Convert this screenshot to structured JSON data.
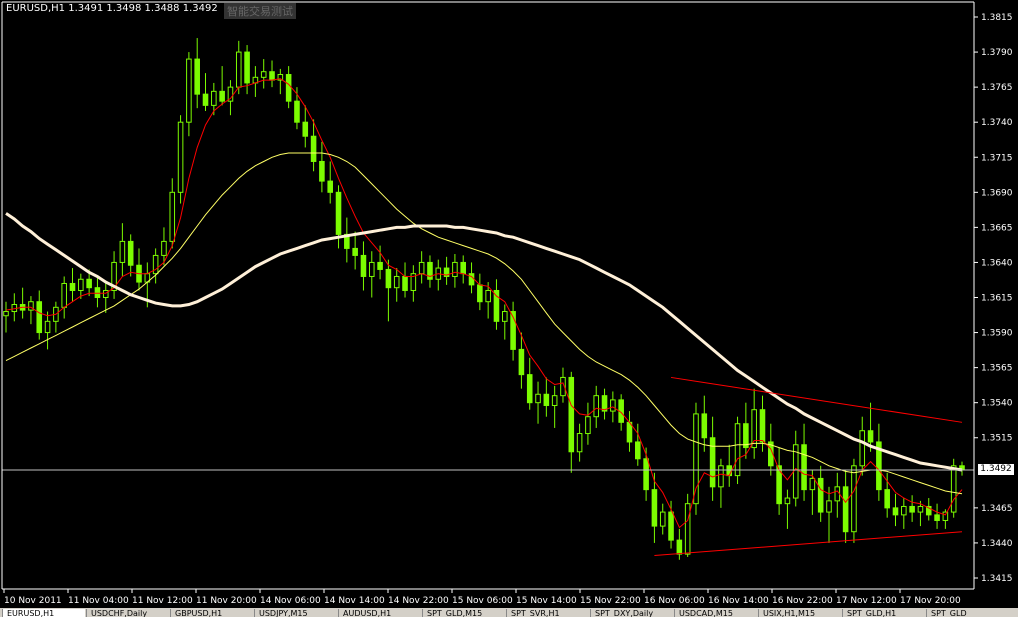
{
  "header": {
    "symbol": "EURUSD,H1",
    "ohlc": "1.3491 1.3498 1.3488 1.3492",
    "watermark": "智能交易测试"
  },
  "current_price_label": "1.3492",
  "colors": {
    "background": "#000000",
    "candle": "#7CFC00",
    "axis": "#ffffff",
    "ma_fast": "#ff0000",
    "ma_mid": "#ffff66",
    "ma_slow": "#fff0d8",
    "trendline": "#ff0000"
  },
  "tabs": [
    "EURUSD,H1",
    "USDCHF,Daily",
    "GBPUSD,H1",
    "USDJPY,M15",
    "AUDUSD,H1",
    "SPT_GLD,M15",
    "SPT_SVR,H1",
    "SPT_DXY,Daily",
    "USDCAD,M15",
    "USIX,H1,M15",
    "SPT_GLD,H1",
    "SPT_GLD"
  ],
  "chart_data": {
    "type": "candlestick",
    "yaxis_ticks": [
      "1.3815",
      "1.3790",
      "1.3765",
      "1.3740",
      "1.3715",
      "1.3690",
      "1.3665",
      "1.3640",
      "1.3615",
      "1.3590",
      "1.3565",
      "1.3540",
      "1.3515",
      "1.3465",
      "1.3440",
      "1.3415"
    ],
    "ylim": [
      1.341,
      1.382
    ],
    "xaxis_ticks": [
      "10 Nov 2011",
      "11 Nov 04:00",
      "11 Nov 12:00",
      "11 Nov 20:00",
      "14 Nov 06:00",
      "14 Nov 14:00",
      "14 Nov 22:00",
      "15 Nov 06:00",
      "15 Nov 14:00",
      "15 Nov 22:00",
      "16 Nov 06:00",
      "16 Nov 14:00",
      "16 Nov 22:00",
      "17 Nov 12:00",
      "17 Nov 20:00"
    ],
    "current_price": 1.3492,
    "candles": [
      [
        1.3602,
        1.3612,
        1.359,
        1.3605
      ],
      [
        1.3605,
        1.3618,
        1.3598,
        1.361
      ],
      [
        1.361,
        1.3622,
        1.36,
        1.3606
      ],
      [
        1.3606,
        1.3616,
        1.3596,
        1.3612
      ],
      [
        1.3612,
        1.362,
        1.3585,
        1.359
      ],
      [
        1.359,
        1.3605,
        1.3578,
        1.3598
      ],
      [
        1.3598,
        1.3612,
        1.359,
        1.3608
      ],
      [
        1.3608,
        1.363,
        1.36,
        1.3625
      ],
      [
        1.3625,
        1.3636,
        1.3612,
        1.362
      ],
      [
        1.362,
        1.3632,
        1.3614,
        1.3628
      ],
      [
        1.3628,
        1.3635,
        1.3616,
        1.3622
      ],
      [
        1.3622,
        1.363,
        1.3608,
        1.3615
      ],
      [
        1.3615,
        1.3626,
        1.3604,
        1.362
      ],
      [
        1.362,
        1.3648,
        1.3614,
        1.364
      ],
      [
        1.364,
        1.3668,
        1.363,
        1.3655
      ],
      [
        1.3655,
        1.366,
        1.363,
        1.3638
      ],
      [
        1.3638,
        1.365,
        1.362,
        1.3626
      ],
      [
        1.3626,
        1.364,
        1.3608,
        1.3632
      ],
      [
        1.3632,
        1.365,
        1.3625,
        1.3645
      ],
      [
        1.3645,
        1.3665,
        1.3638,
        1.3655
      ],
      [
        1.3655,
        1.37,
        1.365,
        1.369
      ],
      [
        1.369,
        1.3745,
        1.3682,
        1.374
      ],
      [
        1.374,
        1.379,
        1.373,
        1.3785
      ],
      [
        1.3785,
        1.38,
        1.375,
        1.376
      ],
      [
        1.376,
        1.3775,
        1.3748,
        1.3752
      ],
      [
        1.3752,
        1.3768,
        1.3745,
        1.3762
      ],
      [
        1.3762,
        1.378,
        1.3752,
        1.3755
      ],
      [
        1.3755,
        1.377,
        1.3745,
        1.3765
      ],
      [
        1.3765,
        1.3798,
        1.376,
        1.379
      ],
      [
        1.379,
        1.3795,
        1.376,
        1.3768
      ],
      [
        1.3768,
        1.378,
        1.3758,
        1.3772
      ],
      [
        1.3772,
        1.3785,
        1.3764,
        1.3776
      ],
      [
        1.3776,
        1.3784,
        1.3765,
        1.377
      ],
      [
        1.377,
        1.3778,
        1.376,
        1.3774
      ],
      [
        1.3774,
        1.378,
        1.375,
        1.3755
      ],
      [
        1.3755,
        1.3765,
        1.3735,
        1.374
      ],
      [
        1.374,
        1.3752,
        1.3722,
        1.373
      ],
      [
        1.373,
        1.3742,
        1.3705,
        1.3712
      ],
      [
        1.3712,
        1.3726,
        1.369,
        1.3698
      ],
      [
        1.3698,
        1.3712,
        1.3682,
        1.369
      ],
      [
        1.369,
        1.3695,
        1.365,
        1.366
      ],
      [
        1.366,
        1.3672,
        1.364,
        1.365
      ],
      [
        1.365,
        1.3662,
        1.3635,
        1.3645
      ],
      [
        1.3645,
        1.3655,
        1.362,
        1.363
      ],
      [
        1.363,
        1.3648,
        1.3615,
        1.364
      ],
      [
        1.364,
        1.3652,
        1.3628,
        1.3635
      ],
      [
        1.3635,
        1.3642,
        1.3598,
        1.3622
      ],
      [
        1.3622,
        1.3636,
        1.3612,
        1.363
      ],
      [
        1.363,
        1.364,
        1.3615,
        1.362
      ],
      [
        1.362,
        1.3638,
        1.3612,
        1.3632
      ],
      [
        1.3632,
        1.3648,
        1.3625,
        1.364
      ],
      [
        1.364,
        1.3645,
        1.3622,
        1.3628
      ],
      [
        1.3628,
        1.3642,
        1.362,
        1.3636
      ],
      [
        1.3636,
        1.3644,
        1.3624,
        1.363
      ],
      [
        1.363,
        1.3646,
        1.3622,
        1.364
      ],
      [
        1.364,
        1.3645,
        1.3625,
        1.3632
      ],
      [
        1.3632,
        1.364,
        1.3618,
        1.3624
      ],
      [
        1.3624,
        1.3632,
        1.3606,
        1.3612
      ],
      [
        1.3612,
        1.3626,
        1.36,
        1.362
      ],
      [
        1.362,
        1.3628,
        1.3592,
        1.3598
      ],
      [
        1.3598,
        1.361,
        1.3585,
        1.3605
      ],
      [
        1.3605,
        1.3612,
        1.357,
        1.3578
      ],
      [
        1.3578,
        1.359,
        1.355,
        1.356
      ],
      [
        1.356,
        1.3572,
        1.3535,
        1.354
      ],
      [
        1.354,
        1.3555,
        1.3525,
        1.3546
      ],
      [
        1.3546,
        1.3558,
        1.353,
        1.3538
      ],
      [
        1.3538,
        1.3552,
        1.3522,
        1.3545
      ],
      [
        1.3545,
        1.3565,
        1.354,
        1.3558
      ],
      [
        1.3558,
        1.3562,
        1.349,
        1.3505
      ],
      [
        1.3505,
        1.3525,
        1.3498,
        1.3518
      ],
      [
        1.3518,
        1.354,
        1.351,
        1.353
      ],
      [
        1.353,
        1.3552,
        1.3522,
        1.3545
      ],
      [
        1.3545,
        1.355,
        1.3528,
        1.3534
      ],
      [
        1.3534,
        1.3548,
        1.3526,
        1.3542
      ],
      [
        1.3542,
        1.3546,
        1.352,
        1.3526
      ],
      [
        1.3526,
        1.3534,
        1.3505,
        1.3512
      ],
      [
        1.3512,
        1.3525,
        1.3495,
        1.35
      ],
      [
        1.35,
        1.3508,
        1.347,
        1.3478
      ],
      [
        1.3478,
        1.349,
        1.344,
        1.3452
      ],
      [
        1.3452,
        1.3468,
        1.3446,
        1.3462
      ],
      [
        1.3462,
        1.347,
        1.3436,
        1.3442
      ],
      [
        1.3442,
        1.345,
        1.3428,
        1.3432
      ],
      [
        1.3432,
        1.3475,
        1.343,
        1.3468
      ],
      [
        1.3468,
        1.354,
        1.346,
        1.3532
      ],
      [
        1.3532,
        1.3545,
        1.3505,
        1.3515
      ],
      [
        1.3515,
        1.353,
        1.347,
        1.348
      ],
      [
        1.348,
        1.35,
        1.3465,
        1.3495
      ],
      [
        1.3495,
        1.351,
        1.348,
        1.3488
      ],
      [
        1.3488,
        1.353,
        1.3482,
        1.3525
      ],
      [
        1.3525,
        1.354,
        1.35,
        1.3508
      ],
      [
        1.3508,
        1.355,
        1.35,
        1.3535
      ],
      [
        1.3535,
        1.3545,
        1.3505,
        1.3512
      ],
      [
        1.3512,
        1.3525,
        1.3488,
        1.3495
      ],
      [
        1.3495,
        1.3508,
        1.346,
        1.3468
      ],
      [
        1.3468,
        1.3478,
        1.345,
        1.3472
      ],
      [
        1.3472,
        1.352,
        1.3466,
        1.351
      ],
      [
        1.351,
        1.3525,
        1.347,
        1.3478
      ],
      [
        1.3478,
        1.3492,
        1.346,
        1.3486
      ],
      [
        1.3486,
        1.3495,
        1.3455,
        1.3462
      ],
      [
        1.3462,
        1.348,
        1.344,
        1.347
      ],
      [
        1.347,
        1.349,
        1.3458,
        1.348
      ],
      [
        1.348,
        1.3492,
        1.344,
        1.3448
      ],
      [
        1.3448,
        1.35,
        1.344,
        1.3495
      ],
      [
        1.3495,
        1.353,
        1.3488,
        1.352
      ],
      [
        1.352,
        1.354,
        1.3505,
        1.3512
      ],
      [
        1.3512,
        1.3525,
        1.347,
        1.3478
      ],
      [
        1.3478,
        1.349,
        1.3458,
        1.3465
      ],
      [
        1.3465,
        1.3475,
        1.3452,
        1.346
      ],
      [
        1.346,
        1.3472,
        1.345,
        1.3466
      ],
      [
        1.3466,
        1.3474,
        1.3455,
        1.3462
      ],
      [
        1.3462,
        1.347,
        1.3452,
        1.3466
      ],
      [
        1.3466,
        1.3472,
        1.3456,
        1.346
      ],
      [
        1.346,
        1.3468,
        1.345,
        1.3456
      ],
      [
        1.3456,
        1.3464,
        1.345,
        1.3462
      ],
      [
        1.3462,
        1.35,
        1.3458,
        1.3495
      ],
      [
        1.3495,
        1.3498,
        1.3488,
        1.3492
      ]
    ],
    "series": [
      {
        "key": "ma_fast",
        "values": [
          1.3606,
          1.3607,
          1.3608,
          1.3608,
          1.3604,
          1.3602,
          1.3603,
          1.3608,
          1.3612,
          1.3616,
          1.3618,
          1.3618,
          1.3618,
          1.3622,
          1.363,
          1.3633,
          1.3632,
          1.3632,
          1.3635,
          1.364,
          1.3652,
          1.3672,
          1.37,
          1.3722,
          1.3738,
          1.3748,
          1.3753,
          1.3757,
          1.3765,
          1.3766,
          1.3768,
          1.377,
          1.377,
          1.3771,
          1.3767,
          1.376,
          1.3751,
          1.374,
          1.3727,
          1.3715,
          1.37,
          1.3686,
          1.3673,
          1.3661,
          1.3654,
          1.3647,
          1.3638,
          1.3635,
          1.363,
          1.363,
          1.3632,
          1.363,
          1.3632,
          1.3631,
          1.3633,
          1.3632,
          1.363,
          1.3624,
          1.3623,
          1.3616,
          1.3612,
          1.3601,
          1.3588,
          1.3574,
          1.3566,
          1.3557,
          1.3553,
          1.3554,
          1.3538,
          1.3532,
          1.3531,
          1.3536,
          1.3535,
          1.3537,
          1.3533,
          1.3526,
          1.3518,
          1.3503,
          1.3484,
          1.3476,
          1.3464,
          1.3451,
          1.3456,
          1.3479,
          1.349,
          1.3487,
          1.3489,
          1.3488,
          1.35,
          1.3503,
          1.3513,
          1.3513,
          1.3507,
          1.3492,
          1.3485,
          1.3493,
          1.3489,
          1.3488,
          1.3478,
          1.3475,
          1.3477,
          1.3469,
          1.3477,
          1.3492,
          1.3498,
          1.3492,
          1.3484,
          1.3476,
          1.3472,
          1.3469,
          1.3468,
          1.3465,
          1.3462,
          1.346,
          1.3471,
          1.3478
        ]
      },
      {
        "key": "ma_mid",
        "values": [
          1.357,
          1.3573,
          1.3576,
          1.3579,
          1.3582,
          1.3585,
          1.3588,
          1.3591,
          1.3594,
          1.3597,
          1.36,
          1.3603,
          1.3606,
          1.3609,
          1.3613,
          1.3617,
          1.3621,
          1.3626,
          1.3631,
          1.3637,
          1.3643,
          1.365,
          1.3658,
          1.3666,
          1.3674,
          1.3681,
          1.3688,
          1.3694,
          1.37,
          1.3705,
          1.3709,
          1.3712,
          1.3715,
          1.3717,
          1.3718,
          1.3718,
          1.3718,
          1.3718,
          1.3718,
          1.3717,
          1.3715,
          1.3712,
          1.3708,
          1.3702,
          1.3696,
          1.369,
          1.3684,
          1.3678,
          1.3673,
          1.3668,
          1.3664,
          1.3661,
          1.3658,
          1.3656,
          1.3654,
          1.3652,
          1.365,
          1.3648,
          1.3646,
          1.3643,
          1.3639,
          1.3634,
          1.3628,
          1.362,
          1.3612,
          1.3604,
          1.3596,
          1.359,
          1.3584,
          1.3578,
          1.3573,
          1.3569,
          1.3566,
          1.3563,
          1.356,
          1.3556,
          1.3551,
          1.3545,
          1.3538,
          1.3531,
          1.3524,
          1.3518,
          1.3514,
          1.3512,
          1.351,
          1.3509,
          1.3509,
          1.3509,
          1.351,
          1.351,
          1.3511,
          1.3511,
          1.351,
          1.3508,
          1.3506,
          1.3505,
          1.3503,
          1.3501,
          1.3498,
          1.3495,
          1.3493,
          1.3491,
          1.349,
          1.3491,
          1.3492,
          1.3492,
          1.3491,
          1.3489,
          1.3487,
          1.3485,
          1.3483,
          1.3481,
          1.3479,
          1.3477,
          1.3476,
          1.3475
        ]
      },
      {
        "key": "ma_slow",
        "values": [
          1.3675,
          1.3671,
          1.3666,
          1.3662,
          1.3657,
          1.3653,
          1.3649,
          1.3645,
          1.3641,
          1.3637,
          1.3633,
          1.363,
          1.3626,
          1.3623,
          1.362,
          1.3617,
          1.3615,
          1.3613,
          1.3611,
          1.361,
          1.3609,
          1.3609,
          1.361,
          1.3612,
          1.3615,
          1.3618,
          1.3621,
          1.3625,
          1.3629,
          1.3633,
          1.3637,
          1.364,
          1.3643,
          1.3646,
          1.3648,
          1.365,
          1.3652,
          1.3654,
          1.3656,
          1.3657,
          1.3658,
          1.3659,
          1.366,
          1.3661,
          1.3662,
          1.3663,
          1.3664,
          1.3665,
          1.3665,
          1.3666,
          1.3666,
          1.3666,
          1.3666,
          1.3666,
          1.3665,
          1.3665,
          1.3664,
          1.3663,
          1.3662,
          1.3661,
          1.3659,
          1.3658,
          1.3656,
          1.3654,
          1.3652,
          1.365,
          1.3648,
          1.3646,
          1.3644,
          1.3642,
          1.3639,
          1.3636,
          1.3633,
          1.363,
          1.3627,
          1.3624,
          1.362,
          1.3616,
          1.3612,
          1.3608,
          1.3603,
          1.3598,
          1.3593,
          1.3588,
          1.3583,
          1.3578,
          1.3573,
          1.3568,
          1.3563,
          1.3559,
          1.3555,
          1.3551,
          1.3547,
          1.3543,
          1.3539,
          1.3536,
          1.3532,
          1.3529,
          1.3526,
          1.3523,
          1.352,
          1.3517,
          1.3514,
          1.3512,
          1.3509,
          1.3507,
          1.3505,
          1.3503,
          1.3501,
          1.3499,
          1.3497,
          1.3496,
          1.3495,
          1.3494,
          1.3493,
          1.3492
        ]
      }
    ],
    "trendlines": [
      {
        "from": [
          80,
          1.3558
        ],
        "to": [
          115,
          1.3526
        ]
      },
      {
        "from": [
          78,
          1.3431
        ],
        "to": [
          115,
          1.3448
        ]
      }
    ]
  }
}
